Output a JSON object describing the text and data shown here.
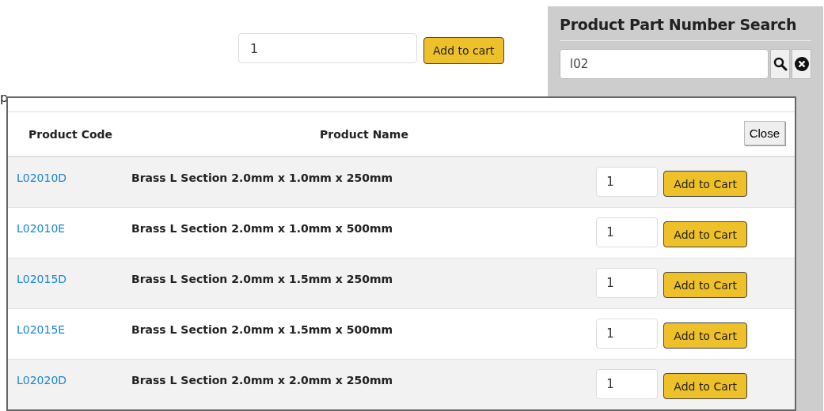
{
  "product_form": {
    "quantity": "1",
    "add_button": "Add to cart"
  },
  "background_text": "p",
  "sidebar": {
    "title": "Product Part Number Search",
    "search_value": "l02"
  },
  "results": {
    "columns": [
      "Product Code",
      "Product Name"
    ],
    "close_button": "Close",
    "rows": [
      {
        "code": "L02010D",
        "name": "Brass L Section 2.0mm x 1.0mm x 250mm",
        "quantity": "1",
        "button": "Add to Cart"
      },
      {
        "code": "L02010E",
        "name": "Brass L Section 2.0mm x 1.0mm x 500mm",
        "quantity": "1",
        "button": "Add to Cart"
      },
      {
        "code": "L02015D",
        "name": "Brass L Section 2.0mm x 1.5mm x 250mm",
        "quantity": "1",
        "button": "Add to Cart"
      },
      {
        "code": "L02015E",
        "name": "Brass L Section 2.0mm x 1.5mm x 500mm",
        "quantity": "1",
        "button": "Add to Cart"
      },
      {
        "code": "L02020D",
        "name": "Brass L Section 2.0mm x 2.0mm x 250mm",
        "quantity": "1",
        "button": "Add to Cart"
      }
    ]
  }
}
